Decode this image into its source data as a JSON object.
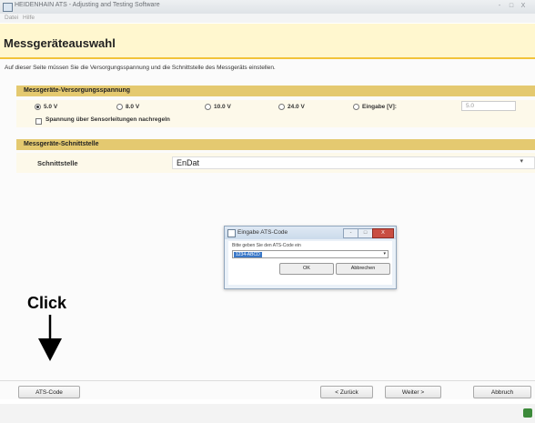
{
  "window": {
    "title": "HEIDENHAIN ATS - Adjusting and Testing Software",
    "controls": [
      "-",
      "□",
      "X"
    ]
  },
  "menu": {
    "items": [
      "Datei",
      "Hilfe"
    ]
  },
  "page": {
    "title": "Messgeräteauswahl",
    "instruction": "Auf dieser Seite müssen Sie die Versorgungsspannung und die Schnittstelle des Messgeräts einstellen."
  },
  "supply": {
    "section_title": "Messgeräte-Versorgungsspannung",
    "options": [
      {
        "label": "5.0 V",
        "checked": true
      },
      {
        "label": "8.0 V",
        "checked": false
      },
      {
        "label": "10.0 V",
        "checked": false
      },
      {
        "label": "24.0 V",
        "checked": false
      },
      {
        "label": "Eingabe [V]:",
        "checked": false
      }
    ],
    "input_value": "5.0",
    "sensor_checkbox_label": "Spannung über Sensorleitungen nachregeln"
  },
  "interface": {
    "section_title": "Messgeräte-Schnittstelle",
    "label": "Schnittstelle",
    "value": "EnDat",
    "arrow": "▾"
  },
  "dialog": {
    "title": "Eingabe ATS-Code",
    "prompt": "Bitte geben Sie den ATS-Code ein",
    "input_value": "1234-ABCD",
    "arrow": "▾",
    "ok_label": "OK",
    "cancel_label": "Abbrechen",
    "controls": [
      "-",
      "□",
      "X"
    ]
  },
  "annotation": {
    "click_label": "Click"
  },
  "footer": {
    "ats_code_label": "ATS-Code",
    "back_label": "< Zurück",
    "next_label": "Weiter >",
    "cancel_label": "Abbruch"
  },
  "colors": {
    "header_bg": "#fff7cf",
    "header_line": "#f2c43a",
    "section_bar": "#e4c970",
    "row_bg": "#fdf9ea",
    "dialog_bg": "#eaf1f8",
    "close_button": "#c94e42",
    "status_icon": "#3c8a3a"
  },
  "icons": {
    "app": "app-icon",
    "status": "status-icon",
    "arrow": "down-arrow-icon"
  }
}
